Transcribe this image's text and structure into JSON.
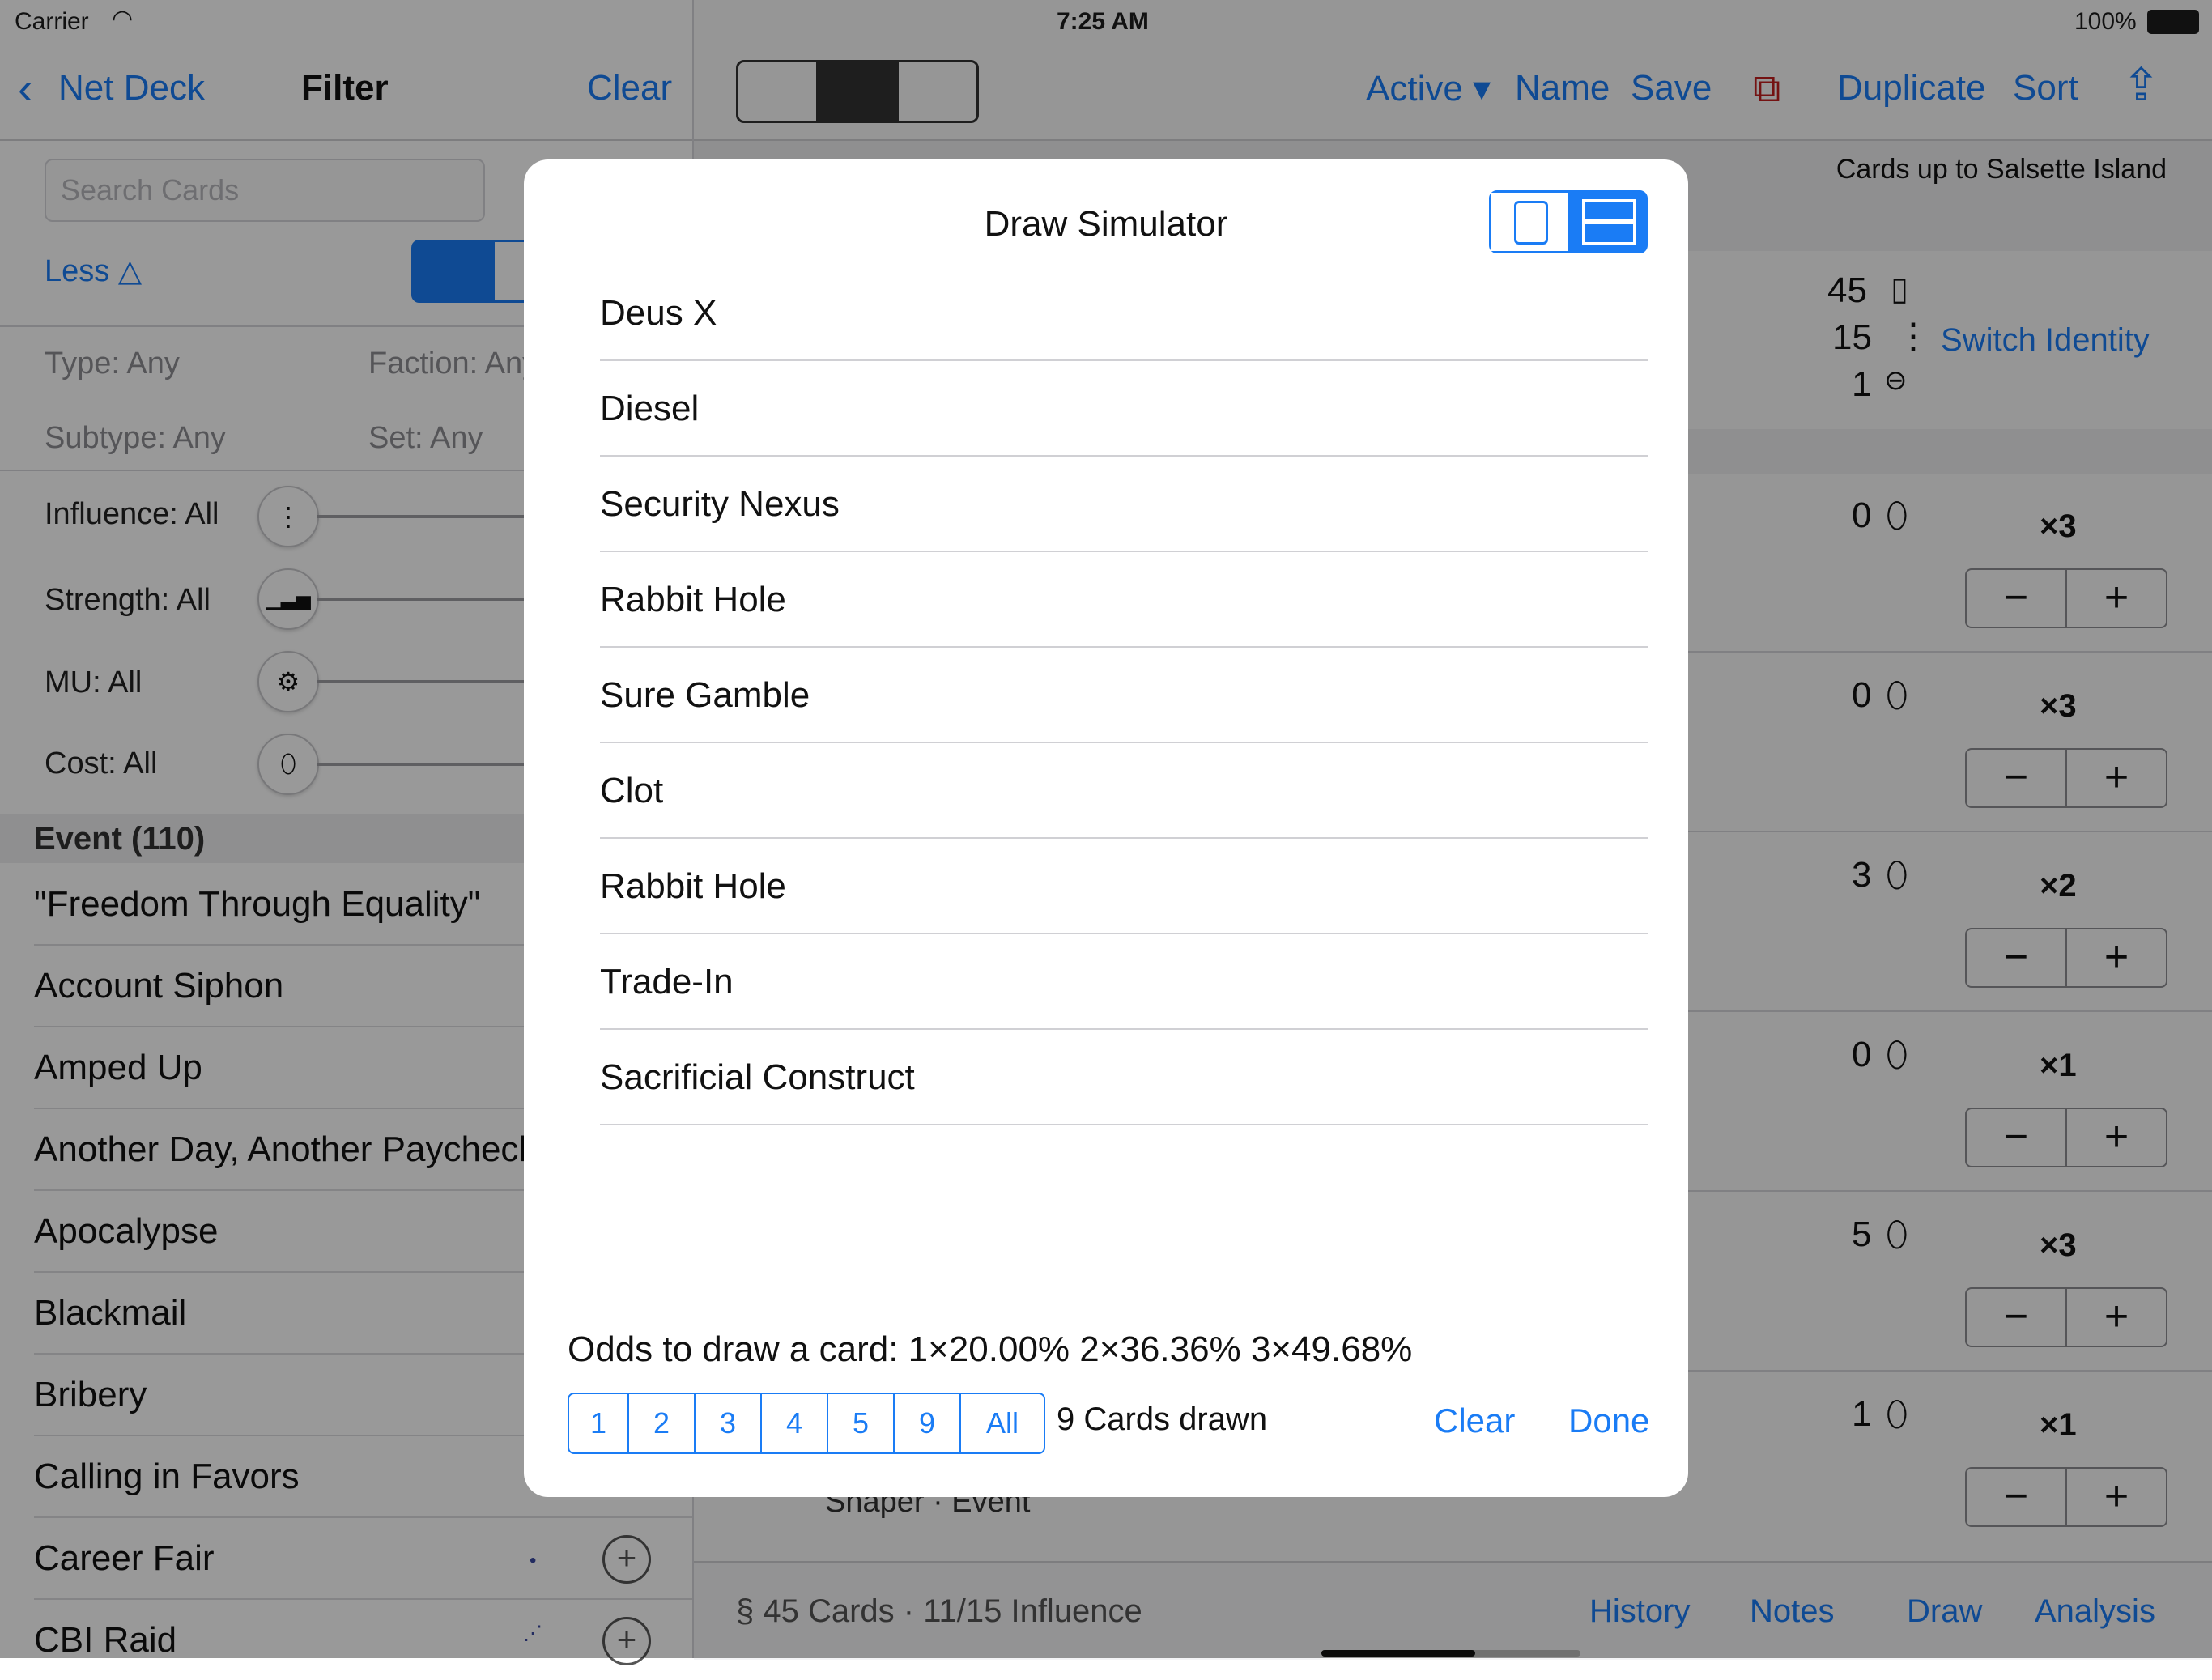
{
  "status_bar": {
    "carrier": "Carrier",
    "time": "7:25 AM",
    "battery": "100%"
  },
  "left": {
    "back_label": "Net Deck",
    "title": "Filter",
    "clear_label": "Clear",
    "search_placeholder": "Search Cards",
    "less_label": "Less △",
    "type": "Type: Any",
    "faction": "Faction: Any",
    "subtype": "Subtype: Any",
    "set": "Set: Any",
    "sliders": [
      {
        "label": "Influence: All",
        "icon": "⋮"
      },
      {
        "label": "Strength: All",
        "icon": "▁▃▅"
      },
      {
        "label": "MU: All",
        "icon": "⚙"
      },
      {
        "label": "Cost: All",
        "icon": "⬯"
      }
    ],
    "section": "Event (110)",
    "cards": [
      "\"Freedom Through Equality\"",
      "Account Siphon",
      "Amped Up",
      "Another Day, Another Paycheck",
      "Apocalypse",
      "Blackmail",
      "Bribery",
      "Calling in Favors",
      "Career Fair",
      "CBI Raid"
    ]
  },
  "right": {
    "active_label": "Active ▾",
    "name_label": "Name",
    "save_label": "Save",
    "duplicate_label": "Duplicate",
    "sort_label": "Sort",
    "header_note": "Cards up to Salsette Island",
    "card_count": "45",
    "influence_count": "15",
    "link_count": "1",
    "switch_identity": "Switch Identity",
    "rows": [
      {
        "cost": "0",
        "mult": "×3"
      },
      {
        "cost": "0",
        "mult": "×3"
      },
      {
        "cost": "3",
        "mult": "×2"
      },
      {
        "cost": "0",
        "mult": "×1"
      },
      {
        "cost": "5",
        "mult": "×3"
      },
      {
        "cost": "1",
        "mult": "×1"
      }
    ],
    "last_row_subtitle": "Shaper · Event",
    "footer_summary": "§  45 Cards · 11/15 Influence",
    "tabs": [
      "History",
      "Notes",
      "Draw",
      "Analysis"
    ]
  },
  "modal": {
    "title": "Draw Simulator",
    "drawn": [
      "Deus X",
      "Diesel",
      "Security Nexus",
      "Rabbit Hole",
      "Sure Gamble",
      "Clot",
      "Rabbit Hole",
      "Trade-In",
      "Sacrificial Construct"
    ],
    "odds": "Odds to draw a card: 1×20.00%  2×36.36%  3×49.68%",
    "draw_buttons": [
      "1",
      "2",
      "3",
      "4",
      "5",
      "9",
      "All"
    ],
    "drawn_count": "9 Cards drawn",
    "clear_label": "Clear",
    "done_label": "Done"
  },
  "colors": {
    "accent": "#1a7cf5",
    "overlay": "rgba(0,0,0,0.40)"
  }
}
